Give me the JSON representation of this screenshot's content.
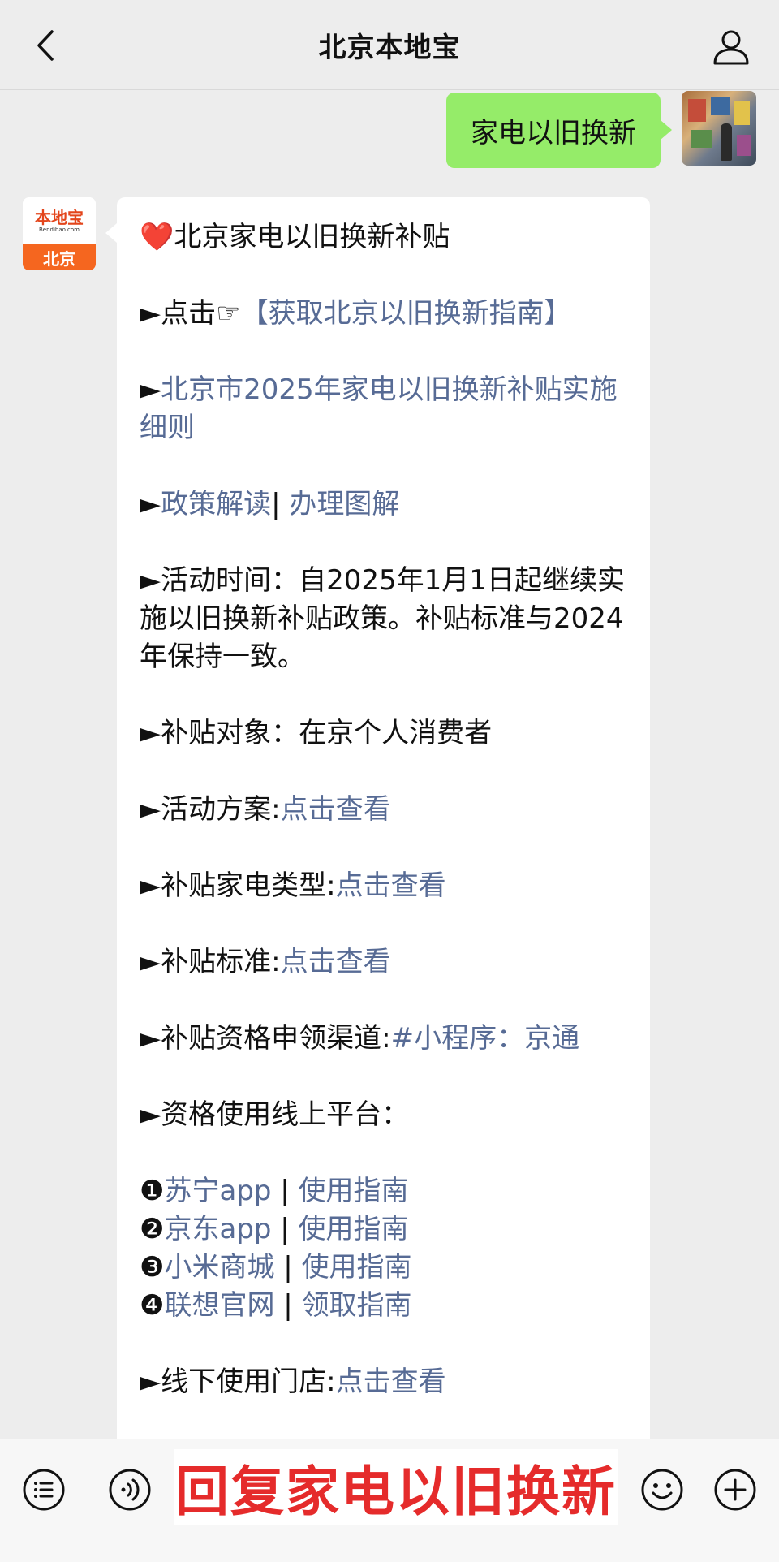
{
  "header": {
    "title": "北京本地宝",
    "back_icon": "chevron-left-icon",
    "profile_icon": "user-icon"
  },
  "outgoing": {
    "text": "家电以旧换新"
  },
  "bot_avatar": {
    "name": "本地宝",
    "url": "Bendibao.com",
    "city": "北京"
  },
  "message": {
    "title_emoji": "❤️",
    "title": "北京家电以旧换新补贴",
    "line1_prefix": "►点击☞",
    "line1_link": "【获取北京以旧换新指南】",
    "line2_arrow": "►",
    "line2_link": "北京市2025年家电以旧换新补贴实施细则",
    "line3_arrow": "►",
    "line3_link_a": "政策解读",
    "line3_sep": "| ",
    "line3_link_b": "办理图解",
    "line4": "►活动时间：自2025年1月1日起继续实施以旧换新补贴政策。补贴标准与2024年保持一致。",
    "line5": "►补贴对象：在京个人消费者",
    "line6_label": "►活动方案:",
    "line6_link": "点击查看",
    "line7_label": "►补贴家电类型:",
    "line7_link": "点击查看",
    "line8_label": "►补贴标准:",
    "line8_link": "点击查看",
    "line9_label": "►补贴资格申领渠道:",
    "line9_link": "#小程序：京通",
    "line10": "►资格使用线上平台：",
    "platforms": [
      {
        "num": "❶",
        "name": "苏宁app",
        "sep": " | ",
        "guide": "使用指南"
      },
      {
        "num": "❷",
        "name": "京东app",
        "sep": " | ",
        "guide": "使用指南"
      },
      {
        "num": "❸",
        "name": "小米商城",
        "sep": " | ",
        "guide": "使用指南"
      },
      {
        "num": "❹",
        "name": "联想官网",
        "sep": " | ",
        "guide": "领取指南"
      }
    ],
    "line11_label": "►线下使用门店:",
    "line11_link": "点击查看"
  },
  "bottom": {
    "reply_text": "回复家电以旧换新",
    "menu_icon": "menu-list-icon",
    "voice_icon": "voice-icon",
    "emoji_icon": "emoji-icon",
    "plus_icon": "plus-icon"
  },
  "colors": {
    "background": "#ededed",
    "bubble_out": "#95ec69",
    "link": "#576b95",
    "reply_text": "#e52b2b"
  }
}
